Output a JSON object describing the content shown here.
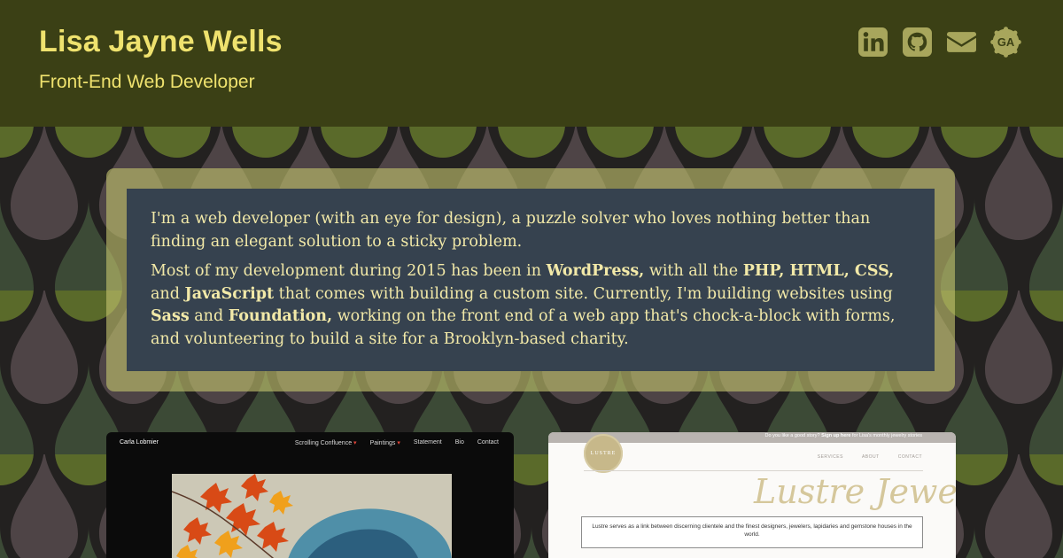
{
  "header": {
    "name": "Lisa Jayne Wells",
    "subtitle": "Front-End Web Developer",
    "social": [
      {
        "icon": "linkedin-icon",
        "label": "LinkedIn"
      },
      {
        "icon": "github-icon",
        "label": "GitHub"
      },
      {
        "icon": "mail-icon",
        "label": "Email"
      },
      {
        "icon": "general-assembly-icon",
        "label": "GA"
      }
    ]
  },
  "intro": {
    "p1": "I'm a web developer (with an eye for design), a puzzle solver who loves nothing better than finding an elegant solution to a sticky problem.",
    "p2": {
      "t1": "Most of my development during 2015 has been in ",
      "wordpress": "WordPress,",
      "t2": " with all the ",
      "php": "PHP, HTML, CSS,",
      "t3": " and ",
      "javascript": "JavaScript",
      "t4": " that comes with building a custom site. Currently, I'm building websites using ",
      "sass": "Sass",
      "t5": " and ",
      "foundation": "Foundation,",
      "t6": " working on the front end of a web app that's chock-a-block with forms, and volunteering to build a site for a Brooklyn-based charity."
    }
  },
  "portfolio": {
    "carla": {
      "name": "Carla Lobmier",
      "nav": [
        "Scrolling Confluence",
        "Paintings",
        "Statement",
        "Bio",
        "Contact"
      ],
      "dropdown_marker": "▾"
    },
    "lustre": {
      "topbar_text": "Do you like a good story?",
      "topbar_link": "Sign up here",
      "topbar_rest": "for Lisa's monthly jewelry stories",
      "logo": "LUSTRE",
      "nav": [
        "SERVICES",
        "ABOUT",
        "CONTACT"
      ],
      "script_title": "Lustre Jewels",
      "description": "Lustre serves as a link between discerning clientele and the finest designers, jewelers, lapidaries and gemstone houses in the world."
    }
  },
  "colors": {
    "header_bg": "#3b4015",
    "accent_yellow": "#efe26e",
    "icon_olive": "#a8a65c",
    "intro_bg": "#36424f",
    "intro_text": "#f2e9a8"
  }
}
